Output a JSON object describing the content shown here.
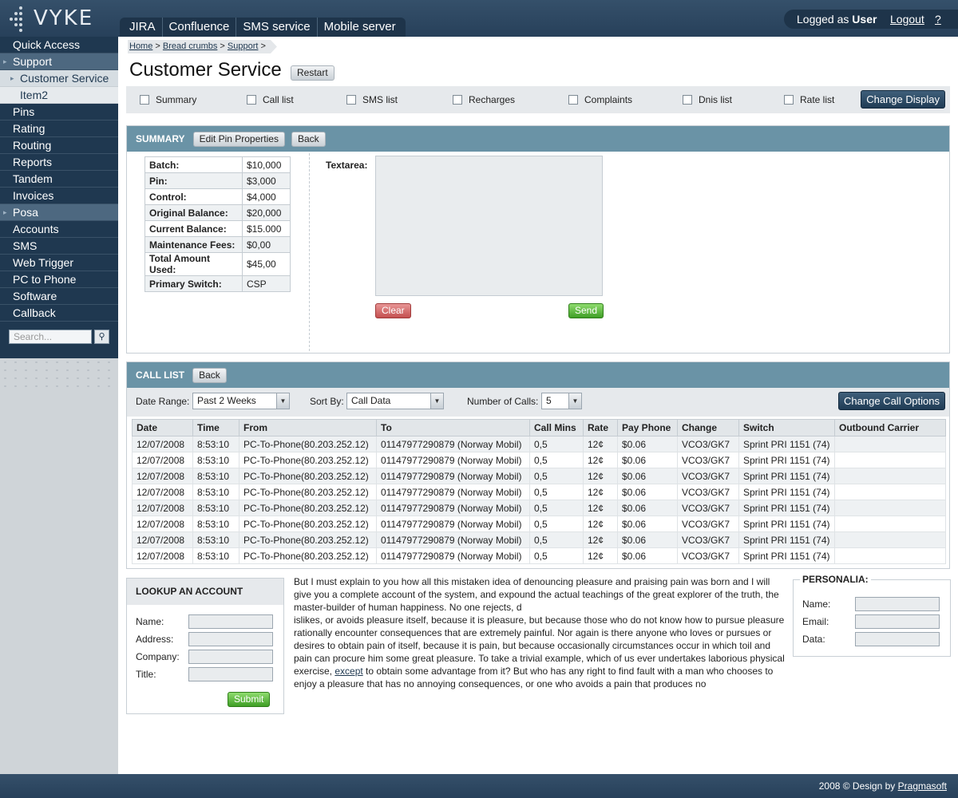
{
  "app": {
    "logo_text": "VYKE"
  },
  "topnav": [
    "JIRA",
    "Confluence",
    "SMS service",
    "Mobile server"
  ],
  "user": {
    "logged_prefix": "Logged as",
    "name": "User",
    "logout": "Logout",
    "help": "?"
  },
  "sidebar": {
    "items": [
      {
        "label": "Quick Access"
      },
      {
        "label": "Support"
      },
      {
        "label": "Customer Service"
      },
      {
        "label": "Item2"
      },
      {
        "label": "Pins"
      },
      {
        "label": "Rating"
      },
      {
        "label": "Routing"
      },
      {
        "label": "Reports"
      },
      {
        "label": "Tandem"
      },
      {
        "label": "Invoices"
      },
      {
        "label": "Posa"
      },
      {
        "label": "Accounts"
      },
      {
        "label": "SMS"
      },
      {
        "label": "Web Trigger"
      },
      {
        "label": "PC to Phone"
      },
      {
        "label": "Software"
      },
      {
        "label": "Callback"
      }
    ],
    "search_placeholder": "Search..."
  },
  "breadcrumb": [
    "Home",
    "Bread crumbs",
    "Support"
  ],
  "page": {
    "title": "Customer Service",
    "restart": "Restart"
  },
  "checkboxes": [
    "Summary",
    "Call list",
    "SMS list",
    "Recharges",
    "Complaints",
    "Dnis list",
    "Rate list"
  ],
  "change_display": "Change Display",
  "summary": {
    "title": "SUMMARY",
    "edit_btn": "Edit Pin Properties",
    "back_btn": "Back",
    "rows": [
      {
        "k": "Batch:",
        "v": "$10,000"
      },
      {
        "k": "Pin:",
        "v": "$3,000"
      },
      {
        "k": "Control:",
        "v": "$4,000"
      },
      {
        "k": "Original Balance:",
        "v": "$20,000"
      },
      {
        "k": "Current Balance:",
        "v": "$15.000"
      },
      {
        "k": "Maintenance Fees:",
        "v": "$0,00"
      },
      {
        "k": "Total Amount Used:",
        "v": "$45,00"
      },
      {
        "k": "Primary Switch:",
        "v": "CSP"
      }
    ],
    "textarea_label": "Textarea:",
    "clear": "Clear",
    "send": "Send"
  },
  "calllist": {
    "title": "CALL LIST",
    "back_btn": "Back",
    "date_range_label": "Date Range:",
    "date_range_value": "Past 2 Weeks",
    "sort_label": "Sort By:",
    "sort_value": "Call Data",
    "num_label": "Number of Calls:",
    "num_value": "5",
    "change_btn": "Change Call Options",
    "columns": [
      "Date",
      "Time",
      "From",
      "To",
      "Call Mins",
      "Rate",
      "Pay Phone",
      "Change",
      "Switch",
      "Outbound Carrier"
    ],
    "rows": [
      [
        "12/07/2008",
        "8:53:10",
        "PC-To-Phone(80.203.252.12)",
        "01147977290879 (Norway Mobil)",
        "0,5",
        "12¢",
        "$0.06",
        "VCO3/GK7",
        "Sprint PRI 1151 (74)",
        ""
      ],
      [
        "12/07/2008",
        "8:53:10",
        "PC-To-Phone(80.203.252.12)",
        "01147977290879 (Norway Mobil)",
        "0,5",
        "12¢",
        "$0.06",
        "VCO3/GK7",
        "Sprint PRI 1151 (74)",
        ""
      ],
      [
        "12/07/2008",
        "8:53:10",
        "PC-To-Phone(80.203.252.12)",
        "01147977290879 (Norway Mobil)",
        "0,5",
        "12¢",
        "$0.06",
        "VCO3/GK7",
        "Sprint PRI 1151 (74)",
        ""
      ],
      [
        "12/07/2008",
        "8:53:10",
        "PC-To-Phone(80.203.252.12)",
        "01147977290879 (Norway Mobil)",
        "0,5",
        "12¢",
        "$0.06",
        "VCO3/GK7",
        "Sprint PRI 1151 (74)",
        ""
      ],
      [
        "12/07/2008",
        "8:53:10",
        "PC-To-Phone(80.203.252.12)",
        "01147977290879 (Norway Mobil)",
        "0,5",
        "12¢",
        "$0.06",
        "VCO3/GK7",
        "Sprint PRI 1151 (74)",
        ""
      ],
      [
        "12/07/2008",
        "8:53:10",
        "PC-To-Phone(80.203.252.12)",
        "01147977290879 (Norway Mobil)",
        "0,5",
        "12¢",
        "$0.06",
        "VCO3/GK7",
        "Sprint PRI 1151 (74)",
        ""
      ],
      [
        "12/07/2008",
        "8:53:10",
        "PC-To-Phone(80.203.252.12)",
        "01147977290879 (Norway Mobil)",
        "0,5",
        "12¢",
        "$0.06",
        "VCO3/GK7",
        "Sprint PRI 1151 (74)",
        ""
      ],
      [
        "12/07/2008",
        "8:53:10",
        "PC-To-Phone(80.203.252.12)",
        "01147977290879 (Norway Mobil)",
        "0,5",
        "12¢",
        "$0.06",
        "VCO3/GK7",
        "Sprint PRI 1151 (74)",
        ""
      ]
    ]
  },
  "lookup": {
    "title": "LOOKUP AN ACCOUNT",
    "fields": [
      "Name:",
      "Address:",
      "Company:",
      "Title:"
    ],
    "submit": "Submit"
  },
  "body_text": {
    "p1": "But I must explain to you how all this mistaken idea of denouncing pleasure and praising pain was born and I will give you a complete account of the system, and expound the actual teachings of the great explorer of the truth, the master-builder of human happiness. No one rejects, d",
    "p2a": "islikes, or avoids pleasure itself, because it is pleasure, but because those who do not know how to pursue pleasure rationally encounter consequences that are extremely painful. Nor again is there anyone who loves or pursues or desires to obtain pain of itself, because it is pain, but because occasionally circumstances occur in which toil and pain can procure him some great pleasure. To take a trivial example, which of us ever undertakes laborious physical exercise, ",
    "link": "except",
    "p2b": " to obtain some advantage from it? But who has any right to find fault with a man who chooses to enjoy a pleasure that has no annoying consequences, or one who avoids a pain that produces no"
  },
  "personalia": {
    "title": "PERSONALIA:",
    "fields": [
      "Name:",
      "Email:",
      "Data:"
    ]
  },
  "footer": {
    "text": "2008 © Design by",
    "link": "Pragmasoft"
  }
}
